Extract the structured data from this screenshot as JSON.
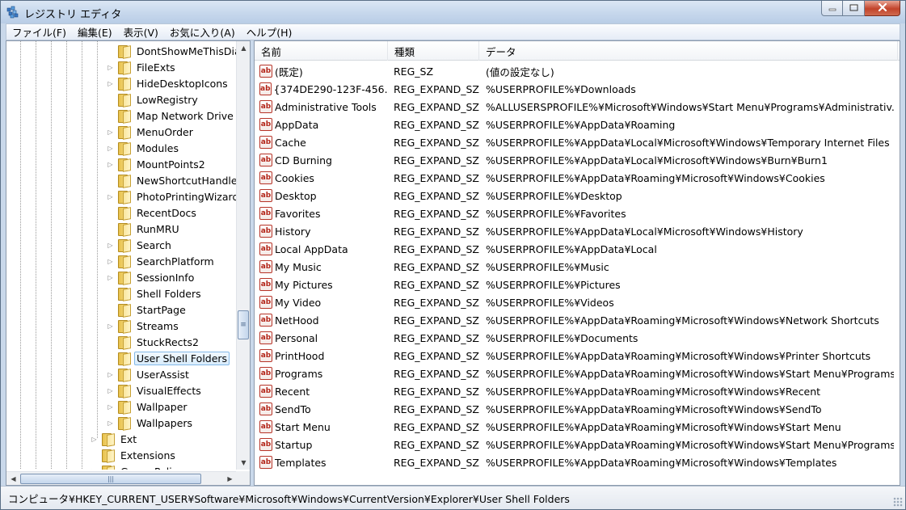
{
  "window": {
    "title": "レジストリ エディタ"
  },
  "menu": [
    "ファイル(F)",
    "編集(E)",
    "表示(V)",
    "お気に入り(A)",
    "ヘルプ(H)"
  ],
  "tree": {
    "items": [
      {
        "label": "DontShowMeThisDialo",
        "expandable": false,
        "level": 2
      },
      {
        "label": "FileExts",
        "expandable": true,
        "level": 2
      },
      {
        "label": "HideDesktopIcons",
        "expandable": true,
        "level": 2
      },
      {
        "label": "LowRegistry",
        "expandable": false,
        "level": 2
      },
      {
        "label": "Map Network Drive M",
        "expandable": false,
        "level": 2
      },
      {
        "label": "MenuOrder",
        "expandable": true,
        "level": 2
      },
      {
        "label": "Modules",
        "expandable": true,
        "level": 2
      },
      {
        "label": "MountPoints2",
        "expandable": true,
        "level": 2
      },
      {
        "label": "NewShortcutHandlers",
        "expandable": false,
        "level": 2
      },
      {
        "label": "PhotoPrintingWizard",
        "expandable": true,
        "level": 2
      },
      {
        "label": "RecentDocs",
        "expandable": false,
        "level": 2
      },
      {
        "label": "RunMRU",
        "expandable": false,
        "level": 2
      },
      {
        "label": "Search",
        "expandable": true,
        "level": 2
      },
      {
        "label": "SearchPlatform",
        "expandable": true,
        "level": 2
      },
      {
        "label": "SessionInfo",
        "expandable": true,
        "level": 2
      },
      {
        "label": "Shell Folders",
        "expandable": false,
        "level": 2
      },
      {
        "label": "StartPage",
        "expandable": false,
        "level": 2
      },
      {
        "label": "Streams",
        "expandable": true,
        "level": 2
      },
      {
        "label": "StuckRects2",
        "expandable": false,
        "level": 2
      },
      {
        "label": "User Shell Folders",
        "expandable": false,
        "level": 2,
        "selected": true
      },
      {
        "label": "UserAssist",
        "expandable": true,
        "level": 2
      },
      {
        "label": "VisualEffects",
        "expandable": true,
        "level": 2
      },
      {
        "label": "Wallpaper",
        "expandable": true,
        "level": 2
      },
      {
        "label": "Wallpapers",
        "expandable": true,
        "level": 2
      },
      {
        "label": "Ext",
        "expandable": true,
        "level": 1
      },
      {
        "label": "Extensions",
        "expandable": false,
        "level": 1
      },
      {
        "label": "Group Policy",
        "expandable": true,
        "level": 1
      }
    ]
  },
  "list": {
    "columns": [
      "名前",
      "種類",
      "データ"
    ],
    "rows": [
      {
        "name": "(既定)",
        "type": "REG_SZ",
        "data": "(値の設定なし)"
      },
      {
        "name": "{374DE290-123F-456...",
        "type": "REG_EXPAND_SZ",
        "data": "%USERPROFILE%¥Downloads"
      },
      {
        "name": "Administrative Tools",
        "type": "REG_EXPAND_SZ",
        "data": "%ALLUSERSPROFILE%¥Microsoft¥Windows¥Start Menu¥Programs¥Administrativ..."
      },
      {
        "name": "AppData",
        "type": "REG_EXPAND_SZ",
        "data": "%USERPROFILE%¥AppData¥Roaming"
      },
      {
        "name": "Cache",
        "type": "REG_EXPAND_SZ",
        "data": "%USERPROFILE%¥AppData¥Local¥Microsoft¥Windows¥Temporary Internet Files"
      },
      {
        "name": "CD Burning",
        "type": "REG_EXPAND_SZ",
        "data": "%USERPROFILE%¥AppData¥Local¥Microsoft¥Windows¥Burn¥Burn1"
      },
      {
        "name": "Cookies",
        "type": "REG_EXPAND_SZ",
        "data": "%USERPROFILE%¥AppData¥Roaming¥Microsoft¥Windows¥Cookies"
      },
      {
        "name": "Desktop",
        "type": "REG_EXPAND_SZ",
        "data": "%USERPROFILE%¥Desktop"
      },
      {
        "name": "Favorites",
        "type": "REG_EXPAND_SZ",
        "data": "%USERPROFILE%¥Favorites"
      },
      {
        "name": "History",
        "type": "REG_EXPAND_SZ",
        "data": "%USERPROFILE%¥AppData¥Local¥Microsoft¥Windows¥History"
      },
      {
        "name": "Local AppData",
        "type": "REG_EXPAND_SZ",
        "data": "%USERPROFILE%¥AppData¥Local"
      },
      {
        "name": "My Music",
        "type": "REG_EXPAND_SZ",
        "data": "%USERPROFILE%¥Music"
      },
      {
        "name": "My Pictures",
        "type": "REG_EXPAND_SZ",
        "data": "%USERPROFILE%¥Pictures"
      },
      {
        "name": "My Video",
        "type": "REG_EXPAND_SZ",
        "data": "%USERPROFILE%¥Videos"
      },
      {
        "name": "NetHood",
        "type": "REG_EXPAND_SZ",
        "data": "%USERPROFILE%¥AppData¥Roaming¥Microsoft¥Windows¥Network Shortcuts"
      },
      {
        "name": "Personal",
        "type": "REG_EXPAND_SZ",
        "data": "%USERPROFILE%¥Documents"
      },
      {
        "name": "PrintHood",
        "type": "REG_EXPAND_SZ",
        "data": "%USERPROFILE%¥AppData¥Roaming¥Microsoft¥Windows¥Printer Shortcuts"
      },
      {
        "name": "Programs",
        "type": "REG_EXPAND_SZ",
        "data": "%USERPROFILE%¥AppData¥Roaming¥Microsoft¥Windows¥Start Menu¥Programs"
      },
      {
        "name": "Recent",
        "type": "REG_EXPAND_SZ",
        "data": "%USERPROFILE%¥AppData¥Roaming¥Microsoft¥Windows¥Recent"
      },
      {
        "name": "SendTo",
        "type": "REG_EXPAND_SZ",
        "data": "%USERPROFILE%¥AppData¥Roaming¥Microsoft¥Windows¥SendTo"
      },
      {
        "name": "Start Menu",
        "type": "REG_EXPAND_SZ",
        "data": "%USERPROFILE%¥AppData¥Roaming¥Microsoft¥Windows¥Start Menu"
      },
      {
        "name": "Startup",
        "type": "REG_EXPAND_SZ",
        "data": "%USERPROFILE%¥AppData¥Roaming¥Microsoft¥Windows¥Start Menu¥Programs..."
      },
      {
        "name": "Templates",
        "type": "REG_EXPAND_SZ",
        "data": "%USERPROFILE%¥AppData¥Roaming¥Microsoft¥Windows¥Templates"
      }
    ],
    "value_icon": "ab-string-icon"
  },
  "status": {
    "path": "コンピュータ¥HKEY_CURRENT_USER¥Software¥Microsoft¥Windows¥CurrentVersion¥Explorer¥User Shell Folders"
  },
  "colors": {
    "selection_border": "#84b9e8",
    "close_button": "#c2432a",
    "string_icon": "#b32418"
  }
}
